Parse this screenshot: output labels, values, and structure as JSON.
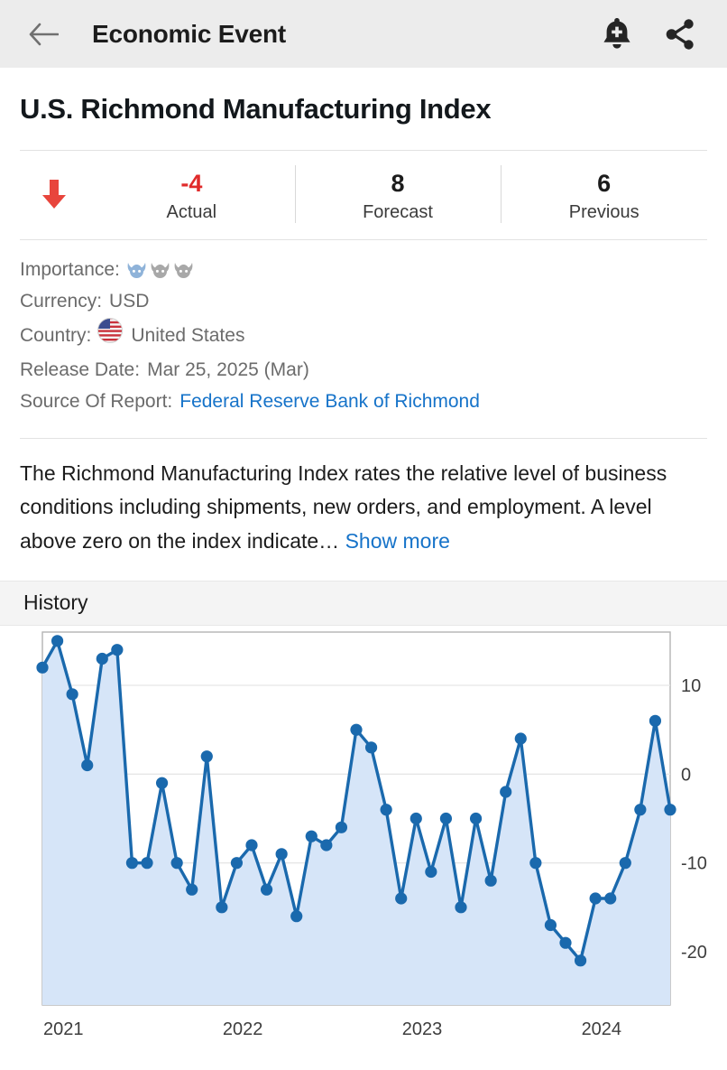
{
  "header": {
    "title": "Economic Event",
    "back_icon": "back-arrow-icon",
    "alert_icon": "bell-plus-icon",
    "share_icon": "share-icon"
  },
  "event": {
    "title": "U.S. Richmond Manufacturing Index",
    "direction_icon": "down-arrow-icon",
    "direction": "down"
  },
  "stats": [
    {
      "value": "-4",
      "label": "Actual",
      "tone": "negative"
    },
    {
      "value": "8",
      "label": "Forecast",
      "tone": "neutral"
    },
    {
      "value": "6",
      "label": "Previous",
      "tone": "neutral"
    }
  ],
  "meta": {
    "importance_label": "Importance:",
    "importance_filled": 1,
    "importance_total": 3,
    "importance_icon": "bull-head-icon",
    "currency_label": "Currency:",
    "currency_value": "USD",
    "country_label": "Country:",
    "country_value": "United States",
    "country_flag_icon": "us-flag-icon",
    "release_label": "Release Date:",
    "release_value": "Mar 25, 2025 (Mar)",
    "source_label": "Source Of Report:",
    "source_value": "Federal Reserve Bank of Richmond"
  },
  "description": {
    "text": "The Richmond Manufacturing Index rates the relative level of business conditions including shipments, new orders, and employment. A level above zero on the index indicate…",
    "show_more": "Show more"
  },
  "history": {
    "label": "History"
  },
  "colors": {
    "accent_blue": "#1a69ad",
    "area_fill": "#d6e5f8",
    "link_blue": "#1673c9",
    "negative_red": "#e02b2b",
    "header_bg": "#ececec",
    "history_bg": "#f4f4f4"
  },
  "chart_data": {
    "type": "area",
    "title": "",
    "xlabel": "",
    "ylabel": "",
    "ylim": [
      -26,
      16
    ],
    "yticks": [
      10,
      0,
      -10,
      -20
    ],
    "ytick_labels": [
      "10",
      "0",
      "-10",
      "-20"
    ],
    "xticks": [
      2021,
      2022,
      2023,
      2024
    ],
    "xtick_labels": [
      "2021",
      "2022",
      "2023",
      "2024"
    ],
    "grid": true,
    "legend": "none",
    "x_start": 2021.0,
    "x_step": 0.0833,
    "values": [
      12,
      15,
      9,
      1,
      13,
      14,
      -10,
      -10,
      -1,
      -10,
      -13,
      2,
      -15,
      -10,
      -8,
      -13,
      -9,
      -16,
      -7,
      -8,
      -6,
      5,
      3,
      -4,
      -14,
      -5,
      -11,
      -5,
      -15,
      -5,
      -12,
      -2,
      4,
      -10,
      -17,
      -19,
      -21,
      -14,
      -14,
      -10,
      -4,
      6,
      -4
    ],
    "last_value": -4,
    "series_color": "#1a69ad",
    "fill_color": "#d6e5f8"
  }
}
